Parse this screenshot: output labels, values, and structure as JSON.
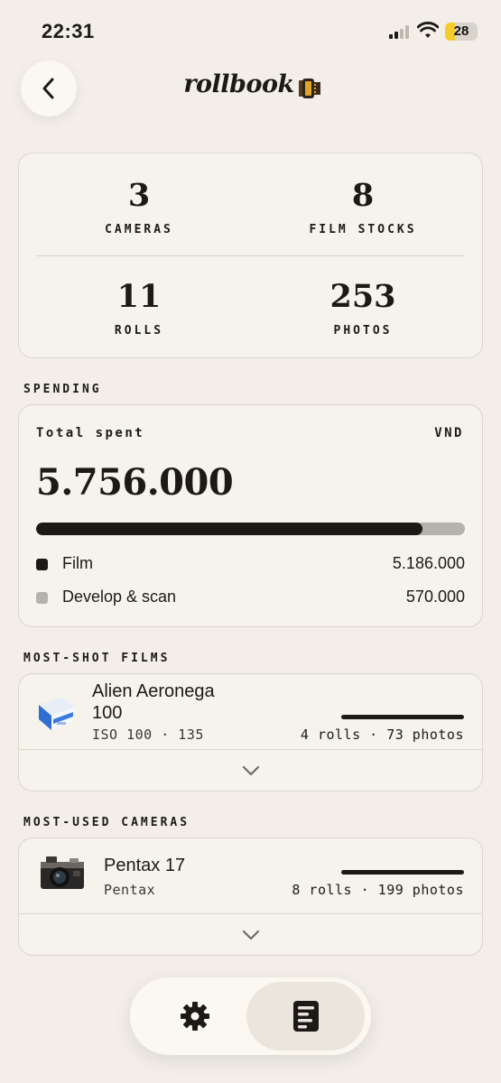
{
  "status_bar": {
    "time": "22:31",
    "battery": "28"
  },
  "header": {
    "title": "rollbook"
  },
  "stats": [
    {
      "value": "3",
      "label": "CAMERAS"
    },
    {
      "value": "8",
      "label": "FILM STOCKS"
    },
    {
      "value": "11",
      "label": "ROLLS"
    },
    {
      "value": "253",
      "label": "PHOTOS"
    }
  ],
  "spending": {
    "section_label": "SPENDING",
    "total_label": "Total spent",
    "currency": "VND",
    "total": "5.756.000",
    "film_fraction": 0.901,
    "breakdown": [
      {
        "label": "Film",
        "value": "5.186.000",
        "color": "#1c1a17"
      },
      {
        "label": "Develop & scan",
        "value": "570.000",
        "color": "#b5b1ab"
      }
    ]
  },
  "films": {
    "section_label": "MOST-SHOT FILMS",
    "items": [
      {
        "name_line1": "Alien Aeronega",
        "name_line2": "100",
        "subtitle": "ISO 100 · 135",
        "stats": "4 rolls · 73 photos",
        "share": 1.0
      }
    ]
  },
  "cameras": {
    "section_label": "MOST-USED CAMERAS",
    "items": [
      {
        "name": "Pentax 17",
        "subtitle": "Pentax",
        "stats": "8 rolls · 199 photos",
        "share": 1.0
      }
    ]
  },
  "tab_bar": {
    "tabs": [
      {
        "icon": "gear-icon",
        "active": false
      },
      {
        "icon": "stats-icon",
        "active": true
      }
    ]
  }
}
